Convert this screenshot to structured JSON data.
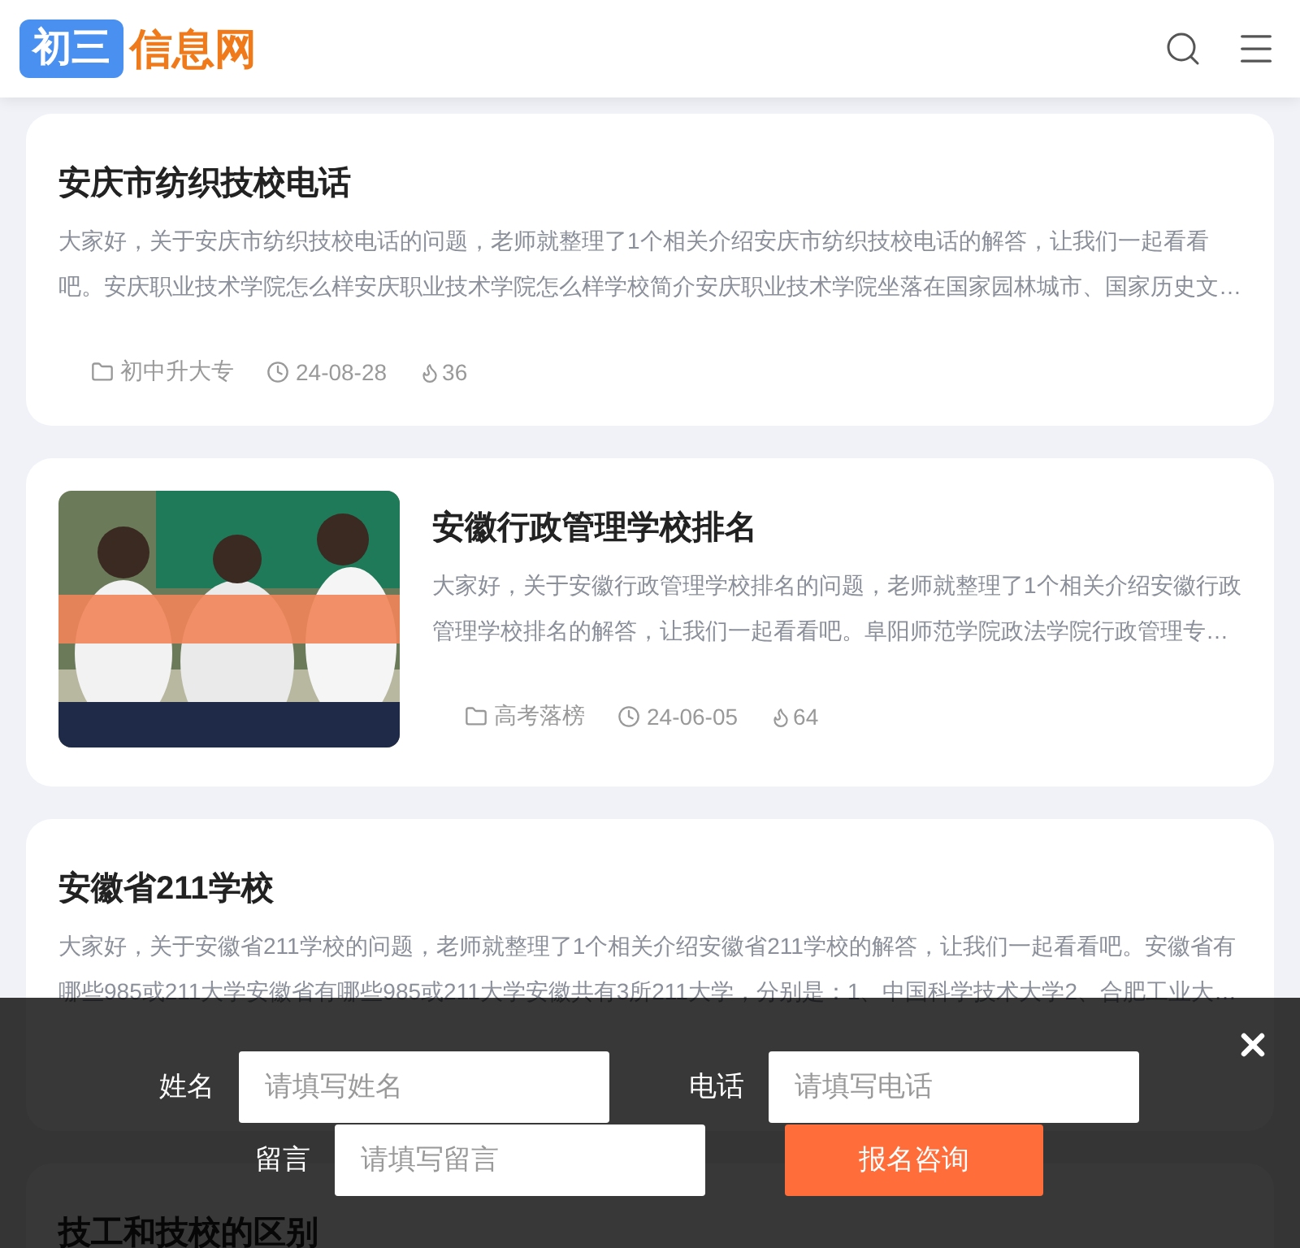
{
  "header": {
    "logo": {
      "badge": "初三",
      "word": "信息网"
    }
  },
  "articles": [
    {
      "title": "安庆市纺织技校电话",
      "excerpt": "大家好，关于安庆市纺织技校电话的问题，老师就整理了1个相关介绍安庆市纺织技校电话的解答，让我们一起看看吧。安庆职业技术学院怎么样安庆职业技术学院怎么样学校简介安庆职业技术学院坐落在国家园林城市、国家历史文…",
      "category": "初中升大专",
      "date": "24-08-28",
      "views": "36"
    },
    {
      "title": "安徽行政管理学校排名",
      "excerpt": "大家好，关于安徽行政管理学校排名的问题，老师就整理了1个相关介绍安徽行政管理学校排名的解答，让我们一起看看吧。阜阳师范学院政法学院行政管理专…",
      "category": "高考落榜",
      "date": "24-06-05",
      "views": "64"
    },
    {
      "title": "安徽省211学校",
      "excerpt": "大家好，关于安徽省211学校的问题，老师就整理了1个相关介绍安徽省211学校的解答，让我们一起看看吧。安徽省有哪些985或211大学安徽省有哪些985或211大学安徽共有3所211大学，分别是：1、中国科学技术大学2、合肥工业大…"
    },
    {
      "title": "技工和技校的区别"
    }
  ],
  "signup_form": {
    "fields": [
      {
        "label": "姓名",
        "placeholder": "请填写姓名"
      },
      {
        "label": "电话",
        "placeholder": "请填写电话"
      },
      {
        "label": "留言",
        "placeholder": "请填写留言"
      }
    ],
    "submit": "报名咨询"
  }
}
